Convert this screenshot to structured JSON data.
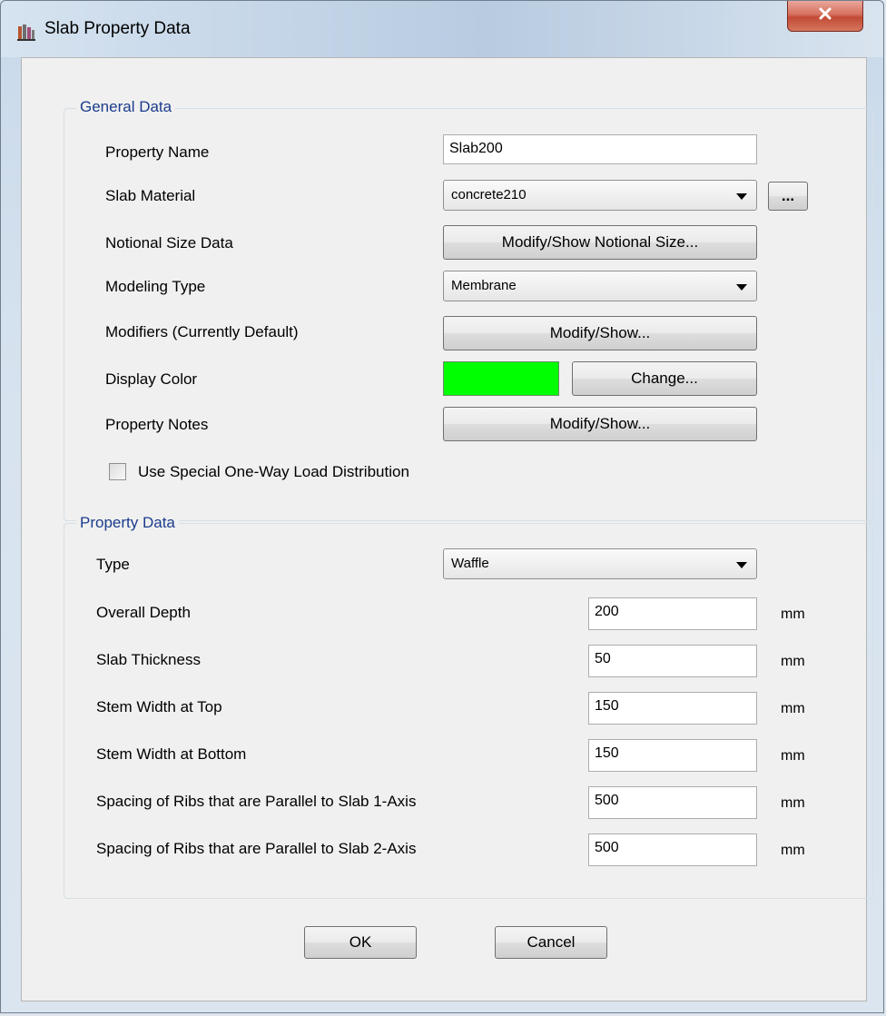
{
  "window": {
    "title": "Slab Property Data",
    "close_glyph": "x"
  },
  "general": {
    "group_title": "General Data",
    "property_name_label": "Property Name",
    "property_name_value": "Slab200",
    "slab_material_label": "Slab Material",
    "slab_material_value": "concrete210",
    "ellipsis_label": "...",
    "notional_label": "Notional Size Data",
    "notional_button": "Modify/Show Notional Size...",
    "modeling_type_label": "Modeling Type",
    "modeling_type_value": "Membrane",
    "modifiers_label": "Modifiers (Currently Default)",
    "modifiers_button": "Modify/Show...",
    "display_color_label": "Display Color",
    "display_color": "#00ff00",
    "change_button": "Change...",
    "notes_label": "Property Notes",
    "notes_button": "Modify/Show...",
    "one_way_label": "Use Special One-Way Load Distribution",
    "one_way_checked": false
  },
  "property": {
    "group_title": "Property Data",
    "type_label": "Type",
    "type_value": "Waffle",
    "rows": [
      {
        "label": "Overall Depth",
        "value": "200",
        "unit": "mm"
      },
      {
        "label": "Slab Thickness",
        "value": "50",
        "unit": "mm"
      },
      {
        "label": "Stem Width at Top",
        "value": "150",
        "unit": "mm"
      },
      {
        "label": "Stem Width at Bottom",
        "value": "150",
        "unit": "mm"
      },
      {
        "label": "Spacing of Ribs that are Parallel to Slab 1-Axis",
        "value": "500",
        "unit": "mm"
      },
      {
        "label": "Spacing of Ribs that are Parallel to Slab 2-Axis",
        "value": "500",
        "unit": "mm"
      }
    ]
  },
  "footer": {
    "ok": "OK",
    "cancel": "Cancel"
  },
  "icons": {
    "app": "etabs-app-icon",
    "close": "close-icon",
    "dropdown": "chevron-down-icon"
  }
}
